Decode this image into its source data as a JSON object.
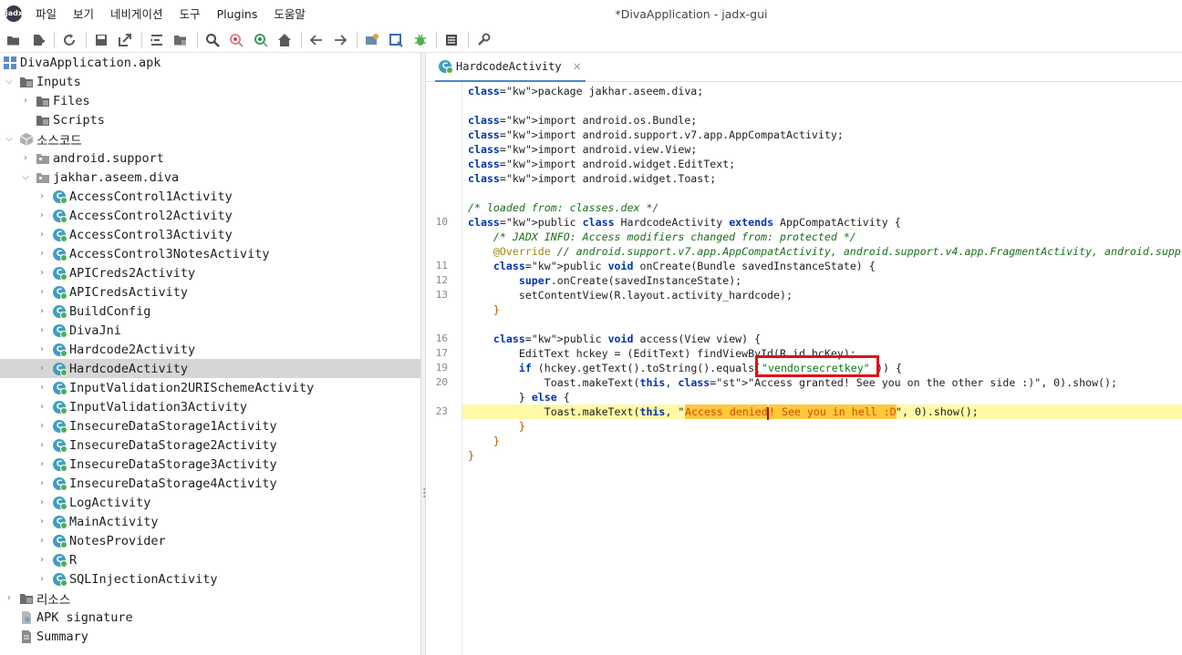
{
  "window": {
    "title": "*DivaApplication - jadx-gui",
    "logo_text": "jadx"
  },
  "menu": [
    "파일",
    "보기",
    "네비게이션",
    "도구",
    "Plugins",
    "도움말"
  ],
  "toolbar": {
    "buttons": [
      "open-file-icon",
      "add-files-icon",
      "reload-icon",
      "save-all-icon",
      "export-gradle-icon",
      "sync-tree-icon",
      "flatten-packages-icon",
      "search-icon",
      "find-usage-icon",
      "find-class-icon",
      "home-icon",
      "back-icon",
      "forward-icon",
      "deobfuscation-icon",
      "quark-icon",
      "debugger-icon",
      "log-viewer-icon",
      "preferences-icon"
    ]
  },
  "tree": {
    "root": "DivaApplication.apk",
    "inputs": "Inputs",
    "files": "Files",
    "scripts": "Scripts",
    "source_code": "소스코드",
    "android_support": "android.support",
    "package": "jakhar.aseem.diva",
    "classes": [
      "AccessControl1Activity",
      "AccessControl2Activity",
      "AccessControl3Activity",
      "AccessControl3NotesActivity",
      "APICreds2Activity",
      "APICredsActivity",
      "BuildConfig",
      "DivaJni",
      "Hardcode2Activity",
      "HardcodeActivity",
      "InputValidation2URISchemeActivity",
      "InputValidation3Activity",
      "InsecureDataStorage1Activity",
      "InsecureDataStorage2Activity",
      "InsecureDataStorage3Activity",
      "InsecureDataStorage4Activity",
      "LogActivity",
      "MainActivity",
      "NotesProvider",
      "R",
      "SQLInjectionActivity"
    ],
    "selected_class": "HardcodeActivity",
    "resources": "리소스",
    "apk_signature": "APK signature",
    "summary": "Summary"
  },
  "editor": {
    "tab_label": "HardcodeActivity",
    "tab_close": "×",
    "class_icon_letter": "C",
    "highlighted_string": "\"vendorsecretkey\"",
    "line_numbers": {
      "l10": "10",
      "l11": "11",
      "l12": "12",
      "l13": "13",
      "l16": "16",
      "l17": "17",
      "l19": "19",
      "l20": "20",
      "l23": "23"
    },
    "code": {
      "pkg": "package jakhar.aseem.diva;",
      "imp1": "import android.os.Bundle;",
      "imp2": "import android.support.v7.app.AppCompatActivity;",
      "imp3": "import android.view.View;",
      "imp4": "import android.widget.EditText;",
      "imp5": "import android.widget.Toast;",
      "loaded": "/* loaded from: classes.dex */",
      "classdecl": "public class HardcodeActivity extends AppCompatActivity {",
      "jadxinfo": "    /* JADX INFO: Access modifiers changed from: protected */",
      "override": "    @Override // android.support.v7.app.AppCompatActivity, android.support.v4.app.FragmentActivity, android.supp",
      "oncreate": "    public void onCreate(Bundle savedInstanceState) {",
      "super": "        super.onCreate(savedInstanceState);",
      "setcontent": "        setContentView(R.layout.activity_hardcode);",
      "close1": "    }",
      "access": "    public void access(View view) {",
      "edittext": "        EditText hckey = (EditText) findViewById(R.id.hcKey);",
      "if_pre": "        if (hckey.getText().toString().equals(",
      "if_post": ")) {",
      "toast1": "            Toast.makeText(this, \"Access granted! See you on the other side :)\", 0).show();",
      "else": "        } else {",
      "toast2_pre": "            Toast.makeText(this, \"",
      "toast2_a": "Access denied",
      "toast2_b": "! See you in hell :D",
      "toast2_post": "\", 0).show();",
      "close2": "        }",
      "close3": "    }",
      "close4": "}"
    }
  }
}
